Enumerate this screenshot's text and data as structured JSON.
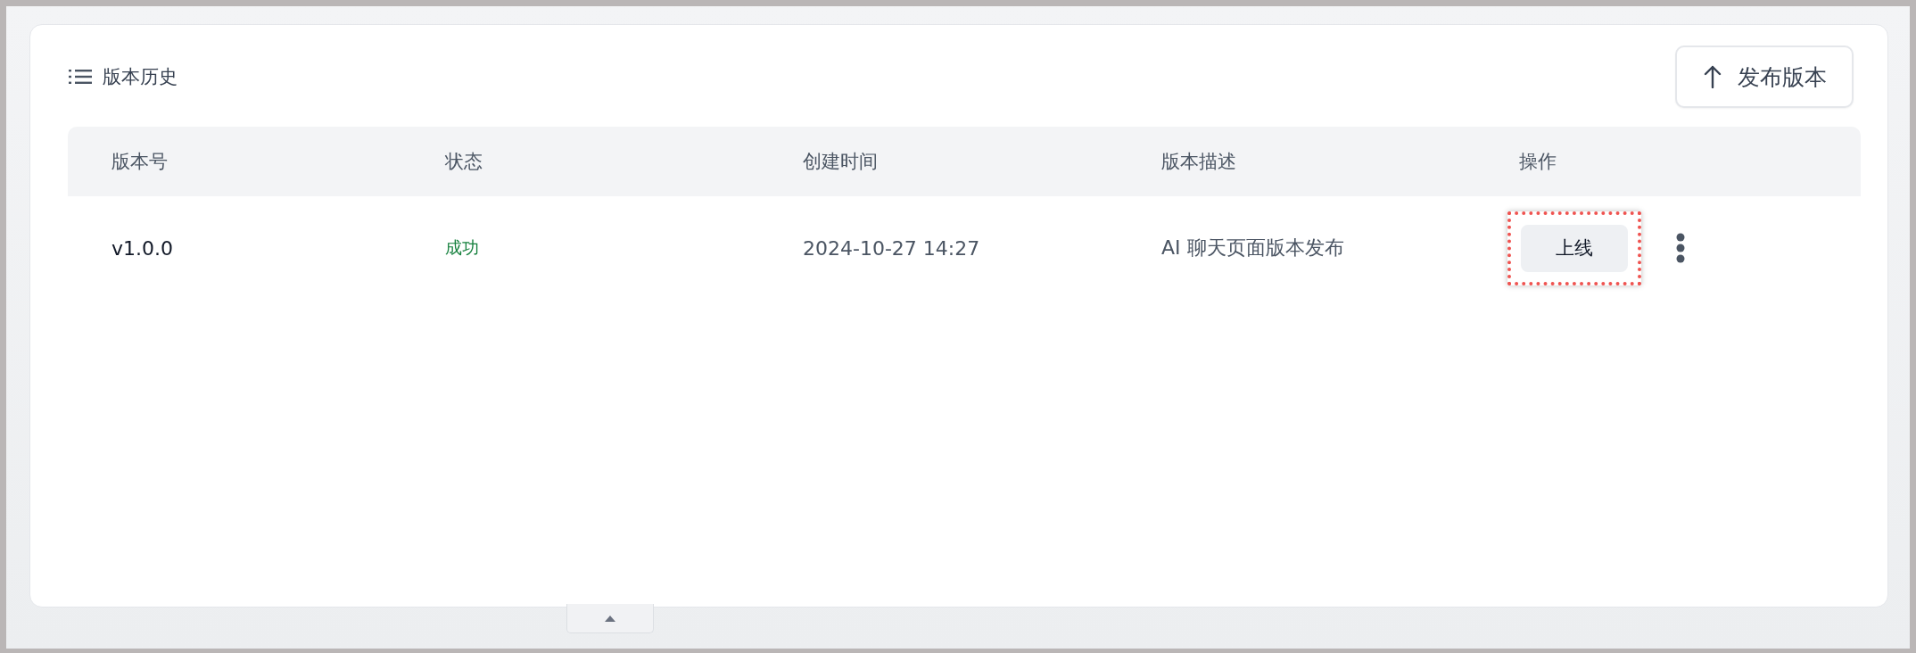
{
  "panel": {
    "title": "版本历史",
    "publish_button": "发布版本"
  },
  "table": {
    "columns": [
      "版本号",
      "状态",
      "创建时间",
      "版本描述",
      "操作"
    ],
    "rows": [
      {
        "version": "v1.0.0",
        "status": {
          "label": "成功",
          "kind": "success"
        },
        "created": "2024-10-27 14:27",
        "description": "AI 聊天页面版本发布",
        "action": {
          "label": "上线",
          "highlighted": true
        }
      }
    ]
  },
  "bottom_handle": {
    "expanded": false
  }
}
